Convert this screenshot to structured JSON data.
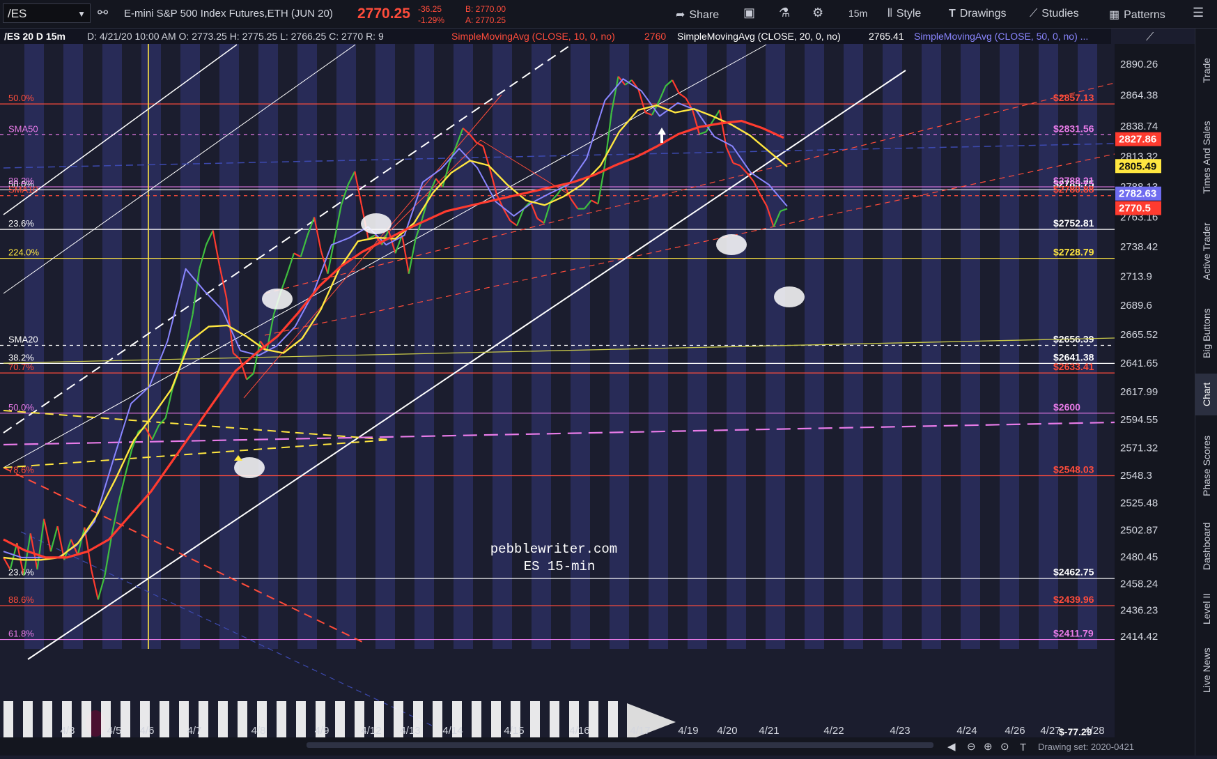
{
  "toolbar": {
    "symbol": "/ES",
    "instrument": "E-mini S&P 500 Index Futures,ETH (JUN 20)",
    "last_price": "2770.25",
    "change": "-36.25",
    "change_pct": "-1.29%",
    "bid": "B: 2770.00",
    "ask": "A: 2770.25",
    "share_label": "Share",
    "timeframe": "15m",
    "style_label": "Style",
    "drawings_label": "Drawings",
    "studies_label": "Studies",
    "patterns_label": "Patterns"
  },
  "sidebar": {
    "tabs": [
      "Trade",
      "Times And Sales",
      "Active Trader",
      "Big Buttons",
      "Chart",
      "Phase Scores",
      "Dashboard",
      "Level II",
      "Live News"
    ],
    "active": "Chart"
  },
  "status": {
    "drawing_set": "Drawing set: 2020-0421"
  },
  "chart_data": {
    "type": "candlestick",
    "header": {
      "symbol_tf": "/ES 20 D 15m",
      "ohlc": "D: 4/21/20 10:00 AM  O: 2773.25  H: 2775.25  L: 2766.25  C: 2770  R: 9",
      "sma10_label": "SimpleMovingAvg (CLOSE, 10, 0, no)",
      "sma10_value": "2760",
      "sma20_label": "SimpleMovingAvg (CLOSE, 20, 0, no)",
      "sma20_value": "2765.41",
      "sma50_label": "SimpleMovingAvg (CLOSE, 50, 0, no) ..."
    },
    "watermark": [
      "pebblewriter.com",
      "ES 15-min"
    ],
    "x_labels": [
      "4/3",
      "4/5",
      "4/6",
      "4/7",
      "4/8",
      "4/9",
      "4/12",
      "4/13",
      "4/14",
      "4/15",
      "4/16",
      "4/17",
      "4/19",
      "4/20",
      "4/21",
      "4/22",
      "4/23",
      "4/24",
      "4/26",
      "4/27",
      "4/28"
    ],
    "y_ticks": [
      "2890.26",
      "2864.38",
      "2838.74",
      "2813.32",
      "2788.13",
      "2763.16",
      "2738.42",
      "2713.9",
      "2689.6",
      "2665.52",
      "2641.65",
      "2617.99",
      "2594.55",
      "2571.32",
      "2548.3",
      "2525.48",
      "2502.87",
      "2480.45",
      "2458.24",
      "2436.23",
      "2414.42"
    ],
    "ylim": [
      2414.42,
      2890.26
    ],
    "series": [
      {
        "name": "Price",
        "values": [
          2480,
          2470,
          2492,
          2465,
          2500,
          2470,
          2512,
          2485,
          2506,
          2478,
          2495,
          2482,
          2505,
          2470,
          2445,
          2465,
          2498,
          2525,
          2548,
          2570,
          2585,
          2588,
          2578,
          2590,
          2596,
          2620,
          2636,
          2656,
          2682,
          2720,
          2740,
          2752,
          2722,
          2696,
          2650,
          2645,
          2628,
          2633,
          2660,
          2652,
          2682,
          2700,
          2716,
          2733,
          2730,
          2748,
          2763,
          2735,
          2716,
          2745,
          2773,
          2790,
          2801,
          2773,
          2745,
          2748,
          2740,
          2752,
          2733,
          2748,
          2716,
          2745,
          2762,
          2782,
          2795,
          2788,
          2808,
          2822,
          2837,
          2832,
          2825,
          2822,
          2803,
          2782,
          2770,
          2760,
          2756,
          2770,
          2776,
          2762,
          2758,
          2776,
          2782,
          2790,
          2778,
          2770,
          2770,
          2777,
          2774,
          2806,
          2850,
          2880,
          2873,
          2877,
          2869,
          2850,
          2848,
          2859,
          2872,
          2877,
          2866,
          2862,
          2852,
          2832,
          2834,
          2843,
          2852,
          2821,
          2808,
          2806,
          2800,
          2793,
          2782,
          2772,
          2755,
          2768,
          2770
        ]
      },
      {
        "name": "SMA 10",
        "values": [
          2485,
          2480,
          2480,
          2480,
          2490,
          2510,
          2560,
          2608,
          2622,
          2660,
          2720,
          2702,
          2686,
          2652,
          2648,
          2656,
          2672,
          2700,
          2740,
          2746,
          2755,
          2740,
          2748,
          2792,
          2803,
          2820,
          2804,
          2776,
          2764,
          2775,
          2783,
          2790,
          2812,
          2860,
          2878,
          2868,
          2847,
          2858,
          2852,
          2830,
          2822,
          2800,
          2790,
          2772
        ]
      },
      {
        "name": "SMA 20",
        "values": [
          2480,
          2478,
          2478,
          2480,
          2492,
          2515,
          2545,
          2578,
          2598,
          2620,
          2660,
          2672,
          2673,
          2664,
          2653,
          2650,
          2662,
          2686,
          2720,
          2743,
          2746,
          2745,
          2758,
          2783,
          2800,
          2810,
          2806,
          2790,
          2777,
          2773,
          2780,
          2790,
          2806,
          2834,
          2852,
          2856,
          2850,
          2853,
          2847,
          2840,
          2831,
          2818,
          2805
        ]
      },
      {
        "name": "SMA 50",
        "values": [
          2495,
          2486,
          2480,
          2480,
          2485,
          2495,
          2515,
          2535,
          2560,
          2585,
          2610,
          2635,
          2650,
          2664,
          2684,
          2706,
          2722,
          2734,
          2743,
          2752,
          2760,
          2768,
          2772,
          2776,
          2780,
          2784,
          2788,
          2792,
          2798,
          2806,
          2813,
          2822,
          2832,
          2838,
          2841,
          2843,
          2837,
          2829
        ]
      }
    ],
    "levels": [
      {
        "price": 2857.13,
        "label": "$2857.13",
        "left": "50.0%",
        "color": "#ff4c3b"
      },
      {
        "price": 2831.56,
        "label": "$2831.56",
        "left": "SMA50",
        "color": "#e87be8",
        "dashed": true
      },
      {
        "price": 2785.75,
        "label": "$2785.75",
        "left": "50.0%",
        "color": "#ffffff"
      },
      {
        "price": 2788.21,
        "label": "$2788.21",
        "left": "38.2%",
        "color": "#e87be8"
      },
      {
        "price": 2780.88,
        "label": "$2780.88",
        "left": "SMA10",
        "color": "#ff4c3b",
        "dashed": true
      },
      {
        "price": 2752.81,
        "label": "$2752.81",
        "left": "23.6%",
        "color": "#ffffff"
      },
      {
        "price": 2728.79,
        "label": "$2728.79",
        "left": "224.0%",
        "color": "#ffe640"
      },
      {
        "price": 2656.39,
        "label": "$2656.39",
        "left": "SMA20",
        "color": "#ffffff",
        "dashed": true
      },
      {
        "price": 2641.38,
        "label": "$2641.38",
        "left": "38.2%",
        "color": "#ffffff"
      },
      {
        "price": 2633.41,
        "label": "$2633.41",
        "left": "70.7%",
        "color": "#ff4c3b"
      },
      {
        "price": 2600,
        "label": "$2600",
        "left": "50.0%",
        "color": "#e87be8"
      },
      {
        "price": 2548.03,
        "label": "$2548.03",
        "left": "78.6%",
        "color": "#ff4c3b"
      },
      {
        "price": 2462.75,
        "label": "$2462.75",
        "left": "23.6%",
        "color": "#ffffff"
      },
      {
        "price": 2439.96,
        "label": "$2439.96",
        "left": "88.6%",
        "color": "#ff4c3b"
      },
      {
        "price": 2411.79,
        "label": "$2411.79",
        "left": "61.8%",
        "color": "#e87be8"
      }
    ],
    "scale_badges": [
      {
        "price": 2827.86,
        "label": "2827.86",
        "bg": "#ff3b2f",
        "fg": "#ffffff"
      },
      {
        "price": 2805.49,
        "label": "2805.49",
        "bg": "#ffe640",
        "fg": "#111111"
      },
      {
        "price": 2782.63,
        "label": "2782.63",
        "bg": "#6f6cf0",
        "fg": "#ffffff"
      },
      {
        "price": 2770.5,
        "label": "2770.5",
        "bg": "#ff3b2f",
        "fg": "#ffffff"
      }
    ],
    "bottom_right_label": "$-77.29",
    "grid": false
  }
}
